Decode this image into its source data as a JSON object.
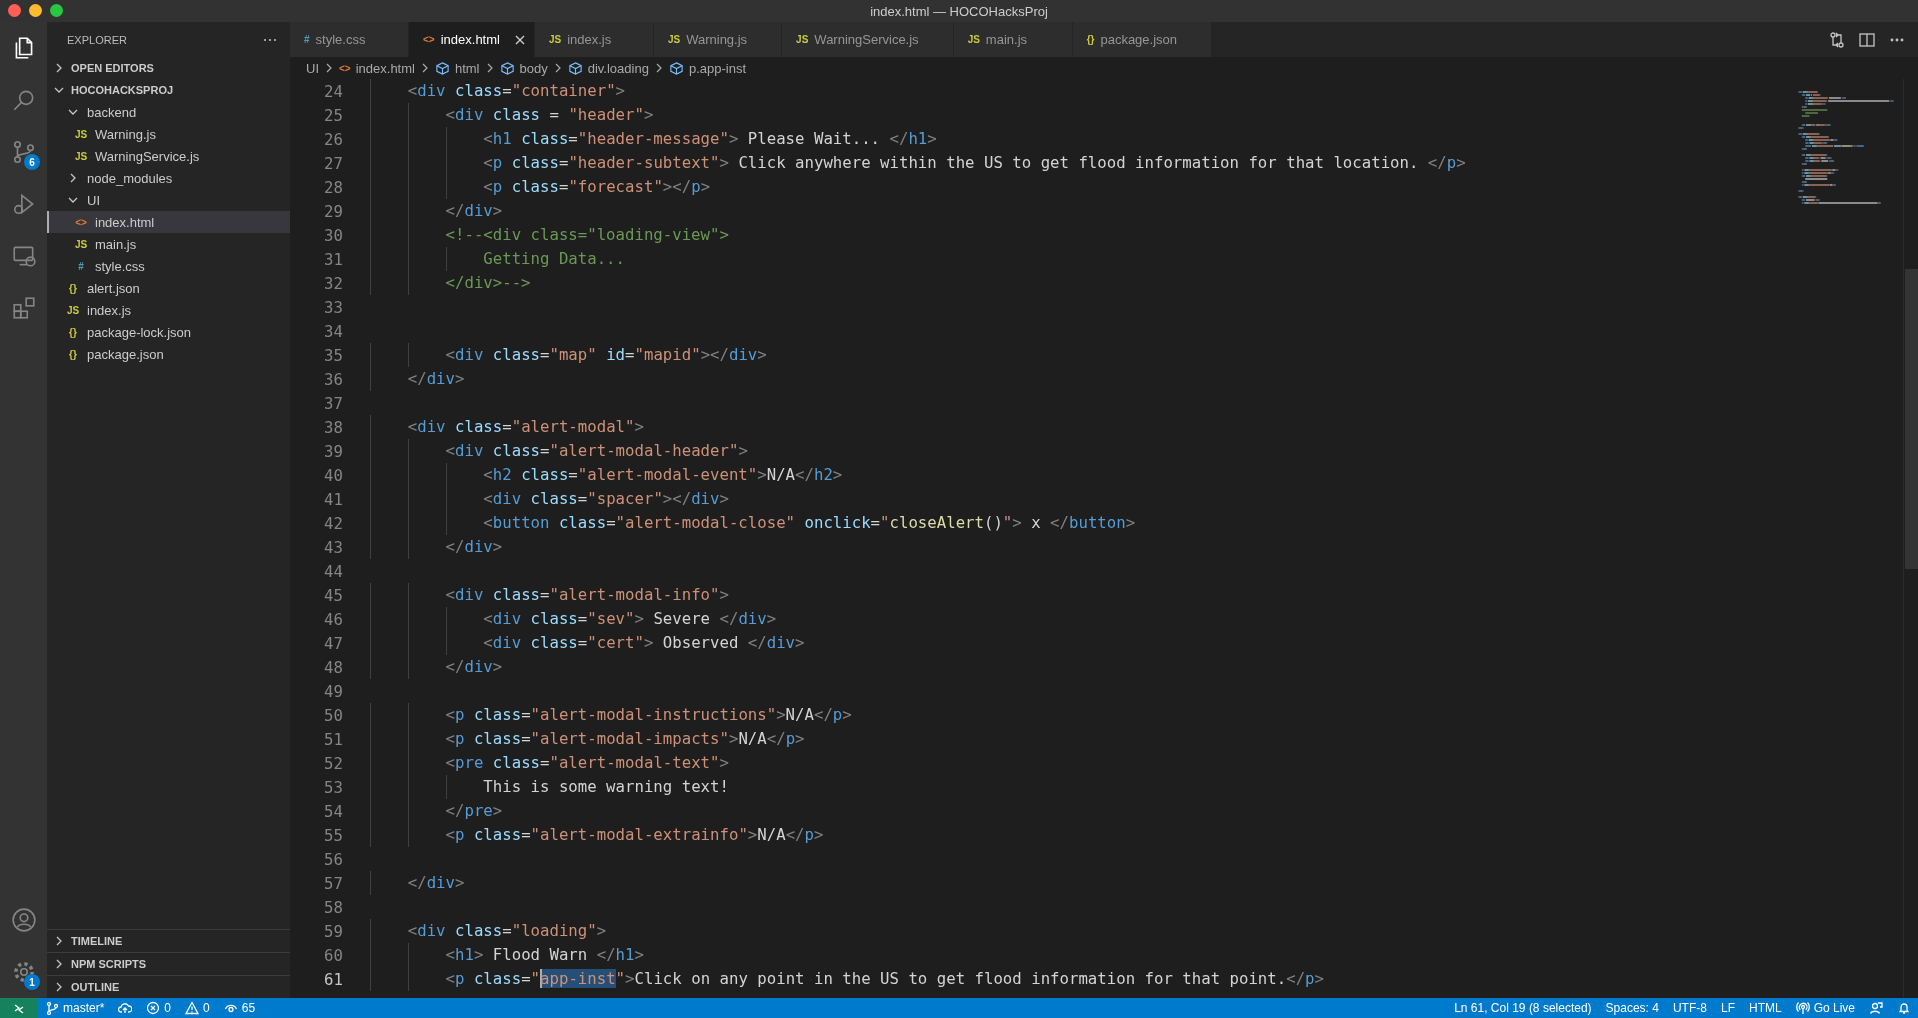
{
  "window": {
    "title": "index.html — HOCOHacksProj"
  },
  "activity_bar": {
    "top": [
      {
        "kind": "explorer",
        "selected": true
      },
      {
        "kind": "search",
        "selected": false
      },
      {
        "kind": "scm",
        "selected": false,
        "badge": "6"
      },
      {
        "kind": "run",
        "selected": false
      },
      {
        "kind": "remote",
        "selected": false
      },
      {
        "kind": "extensions",
        "selected": false
      }
    ],
    "bottom": [
      {
        "kind": "account",
        "selected": false
      },
      {
        "kind": "manage",
        "selected": false,
        "badge": "1"
      }
    ]
  },
  "explorer": {
    "title": "EXPLORER",
    "sections": [
      {
        "title": "OPEN EDITORS",
        "expanded": false
      },
      {
        "title": "HOCOHACKSPROJ",
        "expanded": true,
        "tree": [
          {
            "label": "backend",
            "kind": "folder",
            "expanded": true,
            "selected": false,
            "children": [
              {
                "label": "Warning.js",
                "kind": "js",
                "icon": "JS",
                "selected": false
              },
              {
                "label": "WarningService.js",
                "kind": "js",
                "icon": "JS",
                "selected": false
              }
            ]
          },
          {
            "label": "node_modules",
            "kind": "folder",
            "expanded": false,
            "selected": false
          },
          {
            "label": "UI",
            "kind": "folder",
            "expanded": true,
            "selected": false,
            "children": [
              {
                "label": "index.html",
                "kind": "html",
                "icon": "<>",
                "selected": true
              },
              {
                "label": "main.js",
                "kind": "js",
                "icon": "JS",
                "selected": false
              },
              {
                "label": "style.css",
                "kind": "css",
                "icon": "#",
                "selected": false
              }
            ]
          },
          {
            "label": "alert.json",
            "kind": "json",
            "icon": "{}",
            "selected": false
          },
          {
            "label": "index.js",
            "kind": "js",
            "icon": "JS",
            "selected": false
          },
          {
            "label": "package-lock.json",
            "kind": "json",
            "icon": "{}",
            "selected": false
          },
          {
            "label": "package.json",
            "kind": "json",
            "icon": "{}",
            "selected": false
          }
        ]
      },
      {
        "title": "TIMELINE",
        "expanded": false
      },
      {
        "title": "NPM SCRIPTS",
        "expanded": false
      },
      {
        "title": "OUTLINE",
        "expanded": false
      }
    ]
  },
  "tabs": [
    {
      "label": "style.css",
      "kind": "css",
      "icon": "#",
      "selected": false
    },
    {
      "label": "index.html",
      "kind": "html",
      "icon": "<>",
      "selected": true
    },
    {
      "label": "index.js",
      "kind": "js",
      "icon": "JS",
      "selected": false
    },
    {
      "label": "Warning.js",
      "kind": "js",
      "icon": "JS",
      "selected": false
    },
    {
      "label": "WarningService.js",
      "kind": "js",
      "icon": "JS",
      "selected": false
    },
    {
      "label": "main.js",
      "kind": "js",
      "icon": "JS",
      "selected": false
    },
    {
      "label": "package.json",
      "kind": "json",
      "icon": "{}",
      "selected": false
    }
  ],
  "editor_actions": [
    {
      "kind": "changes"
    },
    {
      "kind": "split"
    },
    {
      "kind": "more"
    }
  ],
  "breadcrumbs": [
    {
      "kind": "folder",
      "label": "UI"
    },
    {
      "kind": "file",
      "icon": "<>",
      "label": "index.html"
    },
    {
      "kind": "element",
      "label": "html"
    },
    {
      "kind": "element",
      "label": "body"
    },
    {
      "kind": "element",
      "label": "div.loading"
    },
    {
      "kind": "element",
      "label": "p.app-inst"
    }
  ],
  "lines": [
    {
      "number": "24",
      "current": false,
      "tokens": [
        {
          "kind": "punct",
          "text": "    <"
        },
        {
          "kind": "tag",
          "text": "div"
        },
        {
          "kind": "attr",
          "text": " class"
        },
        {
          "kind": "text",
          "text": "="
        },
        {
          "kind": "string",
          "text": "\"container\""
        },
        {
          "kind": "punct",
          "text": ">"
        }
      ]
    },
    {
      "number": "25",
      "current": false,
      "tokens": [
        {
          "kind": "punct",
          "text": "        <"
        },
        {
          "kind": "tag",
          "text": "div"
        },
        {
          "kind": "attr",
          "text": " class"
        },
        {
          "kind": "text",
          "text": " = "
        },
        {
          "kind": "string",
          "text": "\"header\""
        },
        {
          "kind": "punct",
          "text": ">"
        }
      ]
    },
    {
      "number": "26",
      "current": false,
      "tokens": [
        {
          "kind": "punct",
          "text": "            <"
        },
        {
          "kind": "tag",
          "text": "h1"
        },
        {
          "kind": "attr",
          "text": " class"
        },
        {
          "kind": "text",
          "text": "="
        },
        {
          "kind": "string",
          "text": "\"header-message\""
        },
        {
          "kind": "punct",
          "text": ">"
        },
        {
          "kind": "text",
          "text": " Please Wait... "
        },
        {
          "kind": "punct",
          "text": "</"
        },
        {
          "kind": "tag",
          "text": "h1"
        },
        {
          "kind": "punct",
          "text": ">"
        }
      ]
    },
    {
      "number": "27",
      "current": false,
      "tokens": [
        {
          "kind": "punct",
          "text": "            <"
        },
        {
          "kind": "tag",
          "text": "p"
        },
        {
          "kind": "attr",
          "text": " class"
        },
        {
          "kind": "text",
          "text": "="
        },
        {
          "kind": "string",
          "text": "\"header-subtext\""
        },
        {
          "kind": "punct",
          "text": ">"
        },
        {
          "kind": "text",
          "text": " Click anywhere within the US to get flood information for that location. "
        },
        {
          "kind": "punct",
          "text": "</"
        },
        {
          "kind": "tag",
          "text": "p"
        },
        {
          "kind": "punct",
          "text": ">"
        }
      ]
    },
    {
      "number": "28",
      "current": false,
      "tokens": [
        {
          "kind": "punct",
          "text": "            <"
        },
        {
          "kind": "tag",
          "text": "p"
        },
        {
          "kind": "attr",
          "text": " class"
        },
        {
          "kind": "text",
          "text": "="
        },
        {
          "kind": "string",
          "text": "\"forecast\""
        },
        {
          "kind": "punct",
          "text": "></"
        },
        {
          "kind": "tag",
          "text": "p"
        },
        {
          "kind": "punct",
          "text": ">"
        }
      ]
    },
    {
      "number": "29",
      "current": false,
      "tokens": [
        {
          "kind": "punct",
          "text": "        </"
        },
        {
          "kind": "tag",
          "text": "div"
        },
        {
          "kind": "punct",
          "text": ">"
        }
      ]
    },
    {
      "number": "30",
      "current": false,
      "tokens": [
        {
          "kind": "comment",
          "text": "        <!--<div class=\"loading-view\">"
        }
      ]
    },
    {
      "number": "31",
      "current": false,
      "tokens": [
        {
          "kind": "comment",
          "text": "            Getting Data..."
        }
      ]
    },
    {
      "number": "32",
      "current": false,
      "tokens": [
        {
          "kind": "comment",
          "text": "        </div>-->"
        }
      ]
    },
    {
      "number": "33",
      "current": false
    },
    {
      "number": "34",
      "current": false
    },
    {
      "number": "35",
      "current": false,
      "tokens": [
        {
          "kind": "punct",
          "text": "        <"
        },
        {
          "kind": "tag",
          "text": "div"
        },
        {
          "kind": "attr",
          "text": " class"
        },
        {
          "kind": "text",
          "text": "="
        },
        {
          "kind": "string",
          "text": "\"map\""
        },
        {
          "kind": "attr",
          "text": " id"
        },
        {
          "kind": "text",
          "text": "="
        },
        {
          "kind": "string",
          "text": "\"mapid\""
        },
        {
          "kind": "punct",
          "text": "></"
        },
        {
          "kind": "tag",
          "text": "div"
        },
        {
          "kind": "punct",
          "text": ">"
        }
      ]
    },
    {
      "number": "36",
      "current": false,
      "tokens": [
        {
          "kind": "punct",
          "text": "    </"
        },
        {
          "kind": "tag",
          "text": "div"
        },
        {
          "kind": "punct",
          "text": ">"
        }
      ]
    },
    {
      "number": "37",
      "current": false
    },
    {
      "number": "38",
      "current": false,
      "tokens": [
        {
          "kind": "punct",
          "text": "    <"
        },
        {
          "kind": "tag",
          "text": "div"
        },
        {
          "kind": "attr",
          "text": " class"
        },
        {
          "kind": "text",
          "text": "="
        },
        {
          "kind": "string",
          "text": "\"alert-modal\""
        },
        {
          "kind": "punct",
          "text": ">"
        }
      ]
    },
    {
      "number": "39",
      "current": false,
      "tokens": [
        {
          "kind": "punct",
          "text": "        <"
        },
        {
          "kind": "tag",
          "text": "div"
        },
        {
          "kind": "attr",
          "text": " class"
        },
        {
          "kind": "text",
          "text": "="
        },
        {
          "kind": "string",
          "text": "\"alert-modal-header\""
        },
        {
          "kind": "punct",
          "text": ">"
        }
      ]
    },
    {
      "number": "40",
      "current": false,
      "tokens": [
        {
          "kind": "punct",
          "text": "            <"
        },
        {
          "kind": "tag",
          "text": "h2"
        },
        {
          "kind": "attr",
          "text": " class"
        },
        {
          "kind": "text",
          "text": "="
        },
        {
          "kind": "string",
          "text": "\"alert-modal-event\""
        },
        {
          "kind": "punct",
          "text": ">"
        },
        {
          "kind": "text",
          "text": "N/A"
        },
        {
          "kind": "punct",
          "text": "</"
        },
        {
          "kind": "tag",
          "text": "h2"
        },
        {
          "kind": "punct",
          "text": ">"
        }
      ]
    },
    {
      "number": "41",
      "current": false,
      "tokens": [
        {
          "kind": "punct",
          "text": "            <"
        },
        {
          "kind": "tag",
          "text": "div"
        },
        {
          "kind": "attr",
          "text": " class"
        },
        {
          "kind": "text",
          "text": "="
        },
        {
          "kind": "string",
          "text": "\"spacer\""
        },
        {
          "kind": "punct",
          "text": "></"
        },
        {
          "kind": "tag",
          "text": "div"
        },
        {
          "kind": "punct",
          "text": ">"
        }
      ]
    },
    {
      "number": "42",
      "current": false,
      "tokens": [
        {
          "kind": "punct",
          "text": "            <"
        },
        {
          "kind": "tag",
          "text": "button"
        },
        {
          "kind": "attr",
          "text": " class"
        },
        {
          "kind": "text",
          "text": "="
        },
        {
          "kind": "string",
          "text": "\"alert-modal-close\""
        },
        {
          "kind": "attr",
          "text": " onclick"
        },
        {
          "kind": "text",
          "text": "="
        },
        {
          "kind": "string",
          "text": "\""
        },
        {
          "kind": "function",
          "text": "closeAlert"
        },
        {
          "kind": "text",
          "text": "()"
        },
        {
          "kind": "string",
          "text": "\""
        },
        {
          "kind": "punct",
          "text": ">"
        },
        {
          "kind": "text",
          "text": " x "
        },
        {
          "kind": "punct",
          "text": "</"
        },
        {
          "kind": "tag",
          "text": "button"
        },
        {
          "kind": "punct",
          "text": ">"
        }
      ]
    },
    {
      "number": "43",
      "current": false,
      "tokens": [
        {
          "kind": "punct",
          "text": "        </"
        },
        {
          "kind": "tag",
          "text": "div"
        },
        {
          "kind": "punct",
          "text": ">"
        }
      ]
    },
    {
      "number": "44",
      "current": false
    },
    {
      "number": "45",
      "current": false,
      "tokens": [
        {
          "kind": "punct",
          "text": "        <"
        },
        {
          "kind": "tag",
          "text": "div"
        },
        {
          "kind": "attr",
          "text": " class"
        },
        {
          "kind": "text",
          "text": "="
        },
        {
          "kind": "string",
          "text": "\"alert-modal-info\""
        },
        {
          "kind": "punct",
          "text": ">"
        }
      ]
    },
    {
      "number": "46",
      "current": false,
      "tokens": [
        {
          "kind": "punct",
          "text": "            <"
        },
        {
          "kind": "tag",
          "text": "div"
        },
        {
          "kind": "attr",
          "text": " class"
        },
        {
          "kind": "text",
          "text": "="
        },
        {
          "kind": "string",
          "text": "\"sev\""
        },
        {
          "kind": "punct",
          "text": ">"
        },
        {
          "kind": "text",
          "text": " Severe "
        },
        {
          "kind": "punct",
          "text": "</"
        },
        {
          "kind": "tag",
          "text": "div"
        },
        {
          "kind": "punct",
          "text": ">"
        }
      ]
    },
    {
      "number": "47",
      "current": false,
      "tokens": [
        {
          "kind": "punct",
          "text": "            <"
        },
        {
          "kind": "tag",
          "text": "div"
        },
        {
          "kind": "attr",
          "text": " class"
        },
        {
          "kind": "text",
          "text": "="
        },
        {
          "kind": "string",
          "text": "\"cert\""
        },
        {
          "kind": "punct",
          "text": ">"
        },
        {
          "kind": "text",
          "text": " Observed "
        },
        {
          "kind": "punct",
          "text": "</"
        },
        {
          "kind": "tag",
          "text": "div"
        },
        {
          "kind": "punct",
          "text": ">"
        }
      ]
    },
    {
      "number": "48",
      "current": false,
      "tokens": [
        {
          "kind": "punct",
          "text": "        </"
        },
        {
          "kind": "tag",
          "text": "div"
        },
        {
          "kind": "punct",
          "text": ">"
        }
      ]
    },
    {
      "number": "49",
      "current": false
    },
    {
      "number": "50",
      "current": false,
      "tokens": [
        {
          "kind": "punct",
          "text": "        <"
        },
        {
          "kind": "tag",
          "text": "p"
        },
        {
          "kind": "attr",
          "text": " class"
        },
        {
          "kind": "text",
          "text": "="
        },
        {
          "kind": "string",
          "text": "\"alert-modal-instructions\""
        },
        {
          "kind": "punct",
          "text": ">"
        },
        {
          "kind": "text",
          "text": "N/A"
        },
        {
          "kind": "punct",
          "text": "</"
        },
        {
          "kind": "tag",
          "text": "p"
        },
        {
          "kind": "punct",
          "text": ">"
        }
      ]
    },
    {
      "number": "51",
      "current": false,
      "tokens": [
        {
          "kind": "punct",
          "text": "        <"
        },
        {
          "kind": "tag",
          "text": "p"
        },
        {
          "kind": "attr",
          "text": " class"
        },
        {
          "kind": "text",
          "text": "="
        },
        {
          "kind": "string",
          "text": "\"alert-modal-impacts\""
        },
        {
          "kind": "punct",
          "text": ">"
        },
        {
          "kind": "text",
          "text": "N/A"
        },
        {
          "kind": "punct",
          "text": "</"
        },
        {
          "kind": "tag",
          "text": "p"
        },
        {
          "kind": "punct",
          "text": ">"
        }
      ]
    },
    {
      "number": "52",
      "current": false,
      "tokens": [
        {
          "kind": "punct",
          "text": "        <"
        },
        {
          "kind": "tag",
          "text": "pre"
        },
        {
          "kind": "attr",
          "text": " class"
        },
        {
          "kind": "text",
          "text": "="
        },
        {
          "kind": "string",
          "text": "\"alert-modal-text\""
        },
        {
          "kind": "punct",
          "text": ">"
        }
      ]
    },
    {
      "number": "53",
      "current": false,
      "tokens": [
        {
          "kind": "text",
          "text": "            This is some warning text!"
        }
      ]
    },
    {
      "number": "54",
      "current": false,
      "tokens": [
        {
          "kind": "punct",
          "text": "        </"
        },
        {
          "kind": "tag",
          "text": "pre"
        },
        {
          "kind": "punct",
          "text": ">"
        }
      ]
    },
    {
      "number": "55",
      "current": false,
      "tokens": [
        {
          "kind": "punct",
          "text": "        <"
        },
        {
          "kind": "tag",
          "text": "p"
        },
        {
          "kind": "attr",
          "text": " class"
        },
        {
          "kind": "text",
          "text": "="
        },
        {
          "kind": "string",
          "text": "\"alert-modal-extrainfo\""
        },
        {
          "kind": "punct",
          "text": ">"
        },
        {
          "kind": "text",
          "text": "N/A"
        },
        {
          "kind": "punct",
          "text": "</"
        },
        {
          "kind": "tag",
          "text": "p"
        },
        {
          "kind": "punct",
          "text": ">"
        }
      ]
    },
    {
      "number": "56",
      "current": false
    },
    {
      "number": "57",
      "current": false,
      "tokens": [
        {
          "kind": "punct",
          "text": "    </"
        },
        {
          "kind": "tag",
          "text": "div"
        },
        {
          "kind": "punct",
          "text": ">"
        }
      ]
    },
    {
      "number": "58",
      "current": false
    },
    {
      "number": "59",
      "current": false,
      "tokens": [
        {
          "kind": "punct",
          "text": "    <"
        },
        {
          "kind": "tag",
          "text": "div"
        },
        {
          "kind": "attr",
          "text": " class"
        },
        {
          "kind": "text",
          "text": "="
        },
        {
          "kind": "string",
          "text": "\"loading\""
        },
        {
          "kind": "punct",
          "text": ">"
        }
      ]
    },
    {
      "number": "60",
      "current": false,
      "tokens": [
        {
          "kind": "punct",
          "text": "        <"
        },
        {
          "kind": "tag",
          "text": "h1"
        },
        {
          "kind": "punct",
          "text": ">"
        },
        {
          "kind": "text",
          "text": " Flood Warn "
        },
        {
          "kind": "punct",
          "text": "</"
        },
        {
          "kind": "tag",
          "text": "h1"
        },
        {
          "kind": "punct",
          "text": ">"
        }
      ]
    },
    {
      "number": "61",
      "current": true,
      "tokens": [
        {
          "kind": "punct",
          "text": "        <"
        },
        {
          "kind": "tag",
          "text": "p"
        },
        {
          "kind": "attr",
          "text": " class"
        },
        {
          "kind": "text",
          "text": "="
        },
        {
          "kind": "string",
          "text": "\""
        },
        {
          "kind": "selection",
          "text": "app-inst"
        },
        {
          "kind": "string",
          "text": "\""
        },
        {
          "kind": "punct",
          "text": ">"
        },
        {
          "kind": "text",
          "text": "Click on any point in the US to get flood information for that point."
        },
        {
          "kind": "punct",
          "text": "</"
        },
        {
          "kind": "tag",
          "text": "p"
        },
        {
          "kind": "punct",
          "text": ">"
        }
      ]
    }
  ],
  "status_bar": {
    "left": [
      {
        "kind": "remote"
      },
      {
        "kind": "branch",
        "text": "master*"
      },
      {
        "kind": "sync"
      },
      {
        "kind": "errors",
        "text": "0"
      },
      {
        "kind": "warnings",
        "text": "0"
      },
      {
        "kind": "views",
        "text": "65"
      }
    ],
    "right": [
      {
        "kind": "plain",
        "text": "Ln 61, Col 19 (8 selected)"
      },
      {
        "kind": "plain",
        "text": "Spaces: 4"
      },
      {
        "kind": "plain",
        "text": "UTF-8"
      },
      {
        "kind": "plain",
        "text": "LF"
      },
      {
        "kind": "plain",
        "text": "HTML"
      },
      {
        "kind": "golive",
        "text": "Go Live"
      },
      {
        "kind": "feedback"
      },
      {
        "kind": "bell"
      }
    ]
  }
}
